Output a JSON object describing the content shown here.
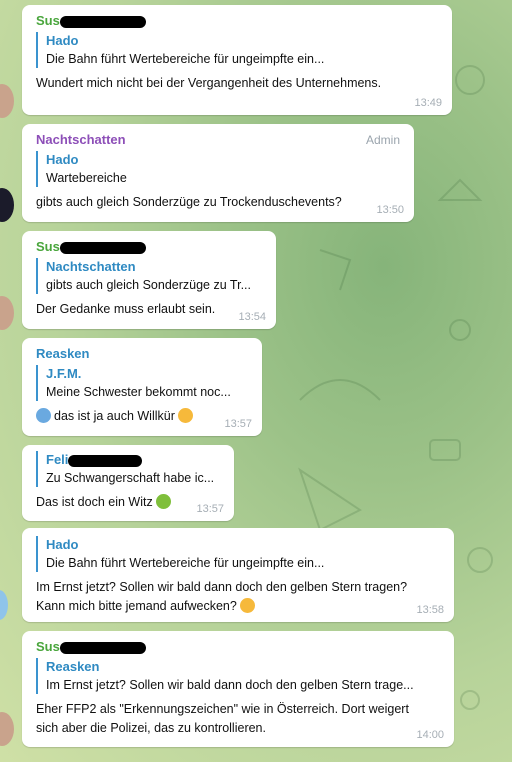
{
  "messages": [
    {
      "sender": "Sus",
      "reply_name": "Hado",
      "reply_text": "Die Bahn führt Wertebereiche für ungeimpfte ein...",
      "text": "Wundert mich nicht bei der Vergangenheit des Unternehmens.",
      "time": "13:49"
    },
    {
      "sender": "Nachtschatten",
      "badge": "Admin",
      "reply_name": "Hado",
      "reply_text": "Wartebereiche",
      "text": "gibts auch gleich Sonderzüge  zu Trockenduschevents?",
      "time": "13:50"
    },
    {
      "sender": "Sus",
      "reply_name": "Nachtschatten",
      "reply_text": "gibts auch gleich Sonderzüge  zu Tr...",
      "text": "Der Gedanke muss erlaubt sein.",
      "time": "13:54"
    },
    {
      "sender": "Reasken",
      "reply_name": "J.F.M.",
      "reply_text": "Meine Schwester bekommt noc...",
      "text": "das ist ja auch Willkür",
      "time": "13:57",
      "emoji_before": "screaming-face-emoji",
      "emoji_after": "persevering-face-emoji"
    },
    {
      "sender": "Feli",
      "reply_text": "Zu Schwangerschaft habe ic...",
      "text": "Das ist doch ein Witz",
      "time": "13:57",
      "emoji_after": "nauseated-face-emoji"
    },
    {
      "reply_name": "Hado",
      "reply_text": "Die Bahn führt Wertebereiche für ungeimpfte ein...",
      "text_line1": "Im Ernst jetzt? Sollen wir bald dann doch den gelben Stern tragen?",
      "text_line2": "Kann mich bitte jemand aufwecken?",
      "time": "13:58",
      "emoji_after": "weary-face-emoji"
    },
    {
      "sender": "Sus",
      "reply_name": "Reasken",
      "reply_text": "Im Ernst jetzt? Sollen wir bald dann doch den gelben Stern trage...",
      "text_line1": "Eher FFP2 als \"Erkennungszeichen\" wie in Österreich. Dort weigert",
      "text_line2": "sich aber die Polizei, das zu kontrollieren.",
      "time": "14:00"
    }
  ],
  "colors": {
    "sender_green": "#4aa63d",
    "sender_purple": "#8d4fb8",
    "sender_blue": "#2f8ac2",
    "reply_bar": "#3a93cf",
    "timestamp": "#a6aeb5"
  }
}
